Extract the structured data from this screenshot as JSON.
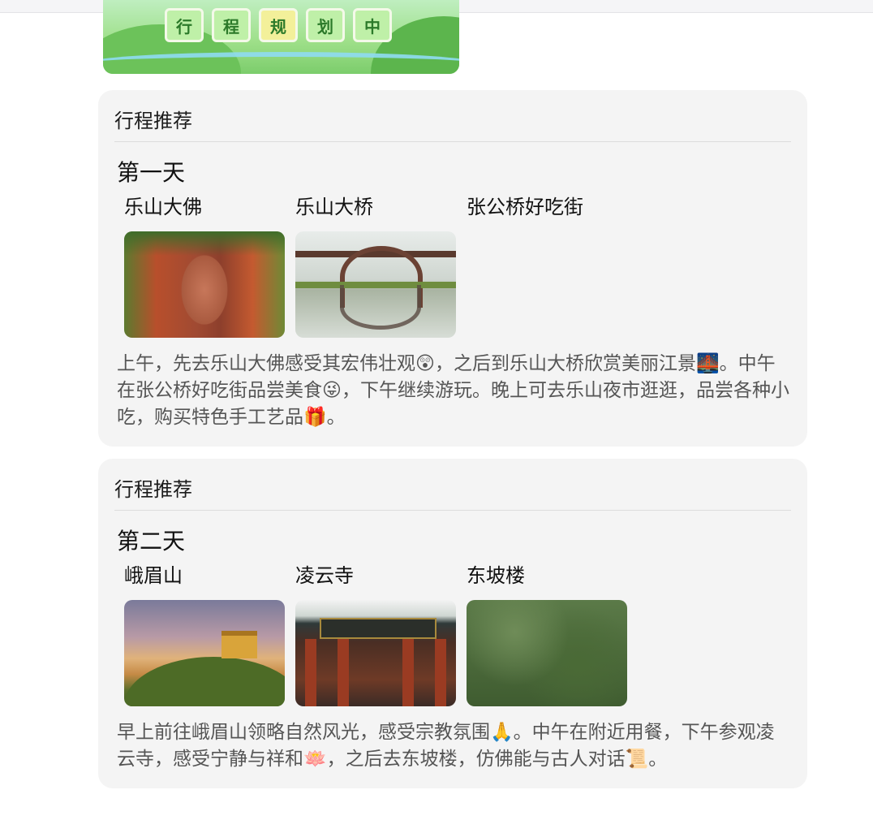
{
  "banner": {
    "tiles": [
      "行",
      "程",
      "规",
      "划",
      "中"
    ]
  },
  "cards": [
    {
      "header": "行程推荐",
      "day": "第一天",
      "spots": [
        {
          "name": "乐山大佛"
        },
        {
          "name": "乐山大桥"
        },
        {
          "name": "张公桥好吃街"
        }
      ],
      "description": "上午，先去乐山大佛感受其宏伟壮观😲，之后到乐山大桥欣赏美丽江景🌉。中午在张公桥好吃街品尝美食😜，下午继续游玩。晚上可去乐山夜市逛逛，品尝各种小吃，购买特色手工艺品🎁。"
    },
    {
      "header": "行程推荐",
      "day": "第二天",
      "spots": [
        {
          "name": "峨眉山"
        },
        {
          "name": "凌云寺"
        },
        {
          "name": "东坡楼"
        }
      ],
      "description": "早上前往峨眉山领略自然风光，感受宗教氛围🙏。中午在附近用餐，下午参观凌云寺，感受宁静与祥和🪷，之后去东坡楼，仿佛能与古人对话📜。"
    }
  ]
}
